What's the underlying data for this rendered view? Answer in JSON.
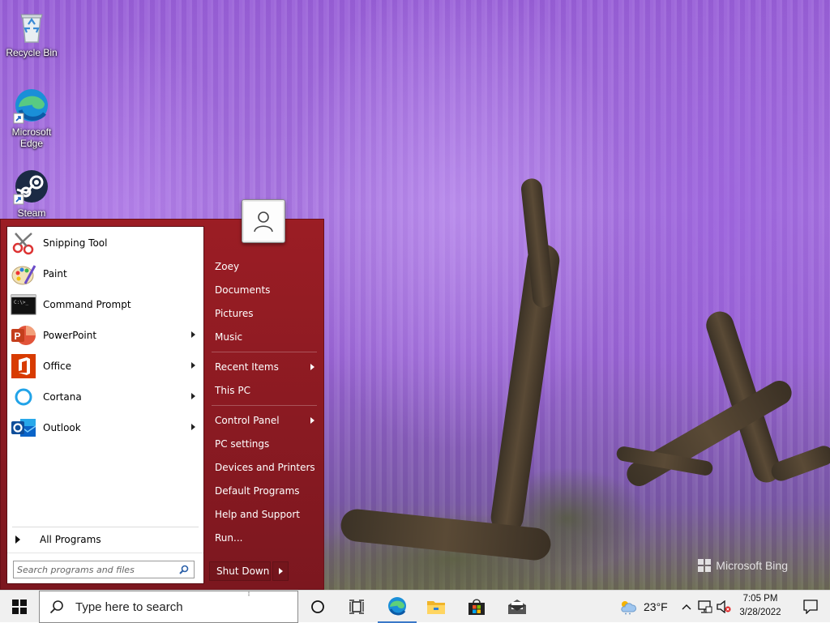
{
  "desktop": {
    "icons": [
      {
        "label": "Recycle Bin",
        "icon": "recycle-bin-icon"
      },
      {
        "label": "Microsoft Edge",
        "icon": "edge-icon"
      },
      {
        "label": "Steam",
        "icon": "steam-icon"
      }
    ],
    "watermark": "Microsoft Bing"
  },
  "start_menu": {
    "pinned": [
      {
        "label": "Snipping Tool",
        "icon": "snipping-tool-icon",
        "submenu": false
      },
      {
        "label": "Paint",
        "icon": "paint-icon",
        "submenu": false
      },
      {
        "label": "Command Prompt",
        "icon": "command-prompt-icon",
        "submenu": false
      },
      {
        "label": "PowerPoint",
        "icon": "powerpoint-icon",
        "submenu": true
      },
      {
        "label": "Office",
        "icon": "office-icon",
        "submenu": true
      },
      {
        "label": "Cortana",
        "icon": "cortana-icon",
        "submenu": true
      },
      {
        "label": "Outlook",
        "icon": "outlook-icon",
        "submenu": true
      }
    ],
    "all_programs": "All Programs",
    "search_placeholder": "Search programs and files",
    "right": [
      {
        "label": "Zoey",
        "submenu": false
      },
      {
        "label": "Documents",
        "submenu": false
      },
      {
        "label": "Pictures",
        "submenu": false
      },
      {
        "label": "Music",
        "submenu": false
      },
      {
        "label": "Recent Items",
        "submenu": true
      },
      {
        "label": "This PC",
        "submenu": false
      },
      {
        "label": "Control Panel",
        "submenu": true
      },
      {
        "label": "PC settings",
        "submenu": false
      },
      {
        "label": "Devices and Printers",
        "submenu": false
      },
      {
        "label": "Default Programs",
        "submenu": false
      },
      {
        "label": "Help and Support",
        "submenu": false
      },
      {
        "label": "Run...",
        "submenu": false
      }
    ],
    "shutdown_label": "Shut Down",
    "colors": {
      "menu_red": "#8a1a22",
      "left_pane": "#ffffff"
    }
  },
  "taskbar": {
    "search_placeholder": "Type here to search",
    "weather": "23°F",
    "time": "7:05 PM",
    "date": "3/28/2022",
    "pinned": [
      "cortana-circle-icon",
      "task-view-icon",
      "edge-icon",
      "file-explorer-icon",
      "store-icon",
      "mail-icon"
    ]
  }
}
